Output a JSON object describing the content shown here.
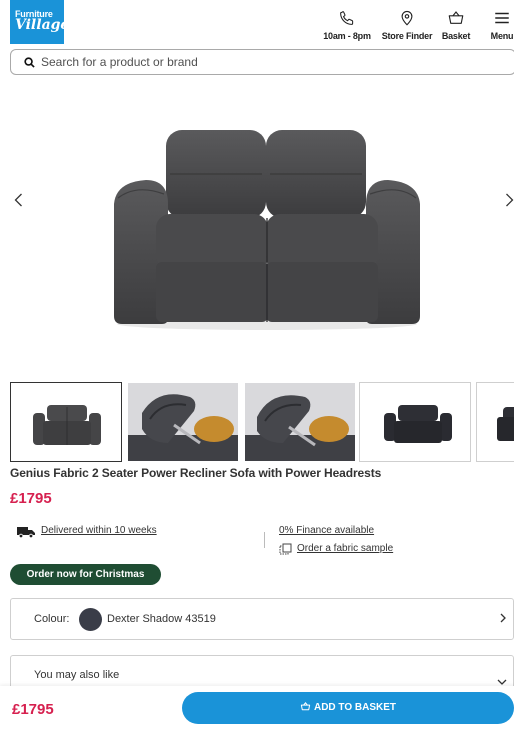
{
  "brand": {
    "logo_line1": "Furniture",
    "logo_line2": "Village"
  },
  "header": {
    "phone_label": "10am - 8pm",
    "store_label": "Store Finder",
    "basket_label": "Basket",
    "menu_label": "Menu"
  },
  "search": {
    "placeholder": "Search for a product or brand"
  },
  "product": {
    "title": "Genius Fabric 2 Seater Power Recliner Sofa with Power Headrests",
    "price": "£1795"
  },
  "info": {
    "delivery": "Delivered within 10 weeks",
    "finance": "0% Finance available",
    "sample": "Order a fabric sample"
  },
  "promo_badge": "Order now for Christmas",
  "colour": {
    "label": "Colour:",
    "value": "Dexter Shadow 43519",
    "swatch_color": "#3a3d48"
  },
  "also_like": {
    "label": "You may also like"
  },
  "bottom_bar": {
    "price": "£1795",
    "add_label": "ADD TO BASKET"
  },
  "colors": {
    "brand_blue": "#1a93d8",
    "price_red": "#d6204f",
    "badge_green": "#1f4d33"
  }
}
